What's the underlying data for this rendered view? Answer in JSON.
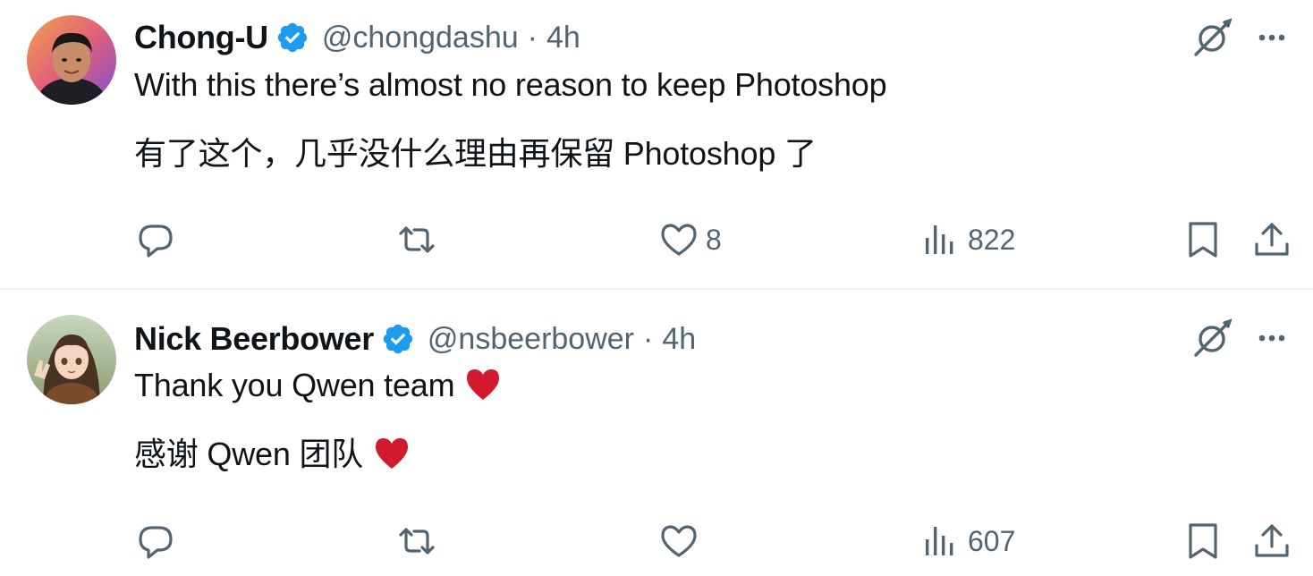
{
  "tweets": [
    {
      "author": {
        "name": "Chong-U",
        "handle": "@chongdashu",
        "verified": true,
        "avatar": "avatar-photo-man"
      },
      "separator": "·",
      "time": "4h",
      "lines": [
        "With this there’s almost no reason to keep Photoshop",
        "有了这个，几乎没什么理由再保留 Photoshop 了"
      ],
      "actions": {
        "reply": "",
        "retweet": "",
        "like": "8",
        "views": "822"
      }
    },
    {
      "author": {
        "name": "Nick Beerbower",
        "handle": "@nsbeerbower",
        "verified": true,
        "avatar": "avatar-anime-girl"
      },
      "separator": "·",
      "time": "4h",
      "lines": [
        "Thank you Qwen team",
        "感谢 Qwen 团队"
      ],
      "emoji": "red-heart",
      "actions": {
        "reply": "",
        "retweet": "",
        "like": "",
        "views": "607"
      }
    }
  ],
  "colors": {
    "text": "#0f1419",
    "secondary": "#536471",
    "verified_blue": "#1d9bf0",
    "divider": "#eff3f4",
    "heart_red": "#d11a2e"
  },
  "icons": [
    "reply-icon",
    "retweet-icon",
    "like-icon",
    "views-icon",
    "bookmark-icon",
    "share-icon",
    "grok-icon",
    "more-icon",
    "verified-badge-icon"
  ]
}
